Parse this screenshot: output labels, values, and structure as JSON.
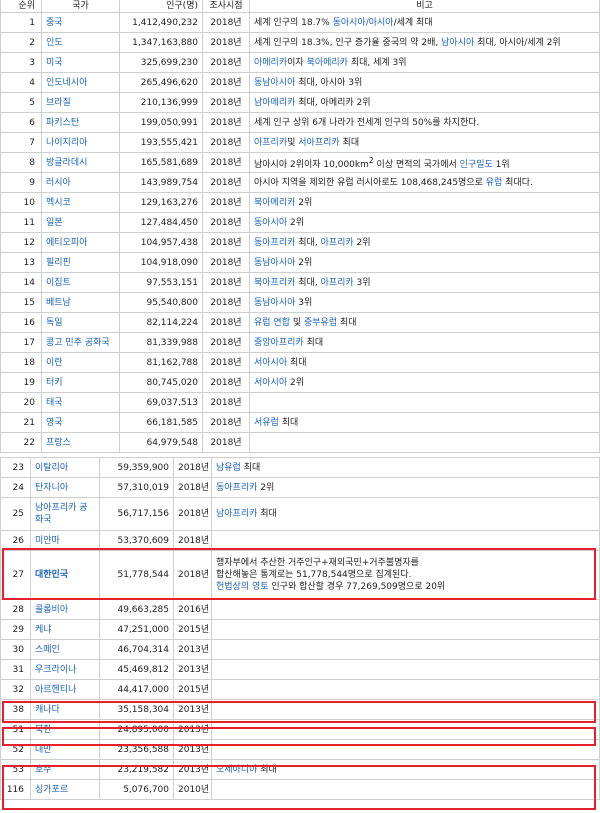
{
  "headers": [
    "순위",
    "국가",
    "인구(명)",
    "조사시점",
    "비고"
  ],
  "rows_top": [
    {
      "rank": "1",
      "country": "중국",
      "pop": "1,412,490,232",
      "year": "2018년",
      "note": [
        [
          "t",
          "세계 인구의 18.7% "
        ],
        [
          "l",
          "동아시아"
        ],
        [
          "l",
          "/아시아"
        ],
        [
          "t",
          "/세계 최대"
        ]
      ]
    },
    {
      "rank": "2",
      "country": "인도",
      "pop": "1,347,163,880",
      "year": "2018년",
      "note": [
        [
          "t",
          "세계 인구의 18.3%, 인구 증가율 중국의 약 2배, "
        ],
        [
          "l",
          "남아시아"
        ],
        [
          "t",
          " 최대, 아시아/세계 2위"
        ]
      ]
    },
    {
      "rank": "3",
      "country": "미국",
      "pop": "325,699,230",
      "year": "2018년",
      "note": [
        [
          "l",
          "아메리카"
        ],
        [
          "t",
          "이자 "
        ],
        [
          "l",
          "북아메리카"
        ],
        [
          "t",
          " 최대, 세계 3위"
        ]
      ]
    },
    {
      "rank": "4",
      "country": "인도네시아",
      "pop": "265,496,620",
      "year": "2018년",
      "note": [
        [
          "l",
          "동남아시아"
        ],
        [
          "t",
          " 최대, 아시아 3위"
        ]
      ]
    },
    {
      "rank": "5",
      "country": "브라질",
      "pop": "210,136,999",
      "year": "2018년",
      "note": [
        [
          "l",
          "남아메리카"
        ],
        [
          "t",
          " 최대, 아메리카 2위"
        ]
      ]
    },
    {
      "rank": "6",
      "country": "파키스탄",
      "pop": "199,050,991",
      "year": "2018년",
      "note": [
        [
          "t",
          "세계 인구 상위 6개 나라가 전세계 인구의 50%를 차지한다."
        ]
      ]
    },
    {
      "rank": "7",
      "country": "나이지리아",
      "pop": "193,555,421",
      "year": "2018년",
      "note": [
        [
          "l",
          "아프리카"
        ],
        [
          "t",
          "및 "
        ],
        [
          "l",
          "서아프리카"
        ],
        [
          "t",
          " 최대"
        ]
      ]
    },
    {
      "rank": "8",
      "country": "방글라데시",
      "pop": "165,581,689",
      "year": "2018년",
      "note": [
        [
          "t",
          "남아시아 2위이자 10,000km"
        ],
        [
          "s",
          "2"
        ],
        [
          "t",
          " 이상 면적의 국가에서 "
        ],
        [
          "l",
          "인구밀도"
        ],
        [
          "t",
          " 1위"
        ]
      ]
    },
    {
      "rank": "9",
      "country": "러시아",
      "pop": "143,989,754",
      "year": "2018년",
      "note": [
        [
          "t",
          "아시아 지역을 제외한 유럽 러시아로도 108,468,245명으로 "
        ],
        [
          "l",
          "유럽"
        ],
        [
          "t",
          " 최대다."
        ]
      ]
    },
    {
      "rank": "10",
      "country": "멕시코",
      "pop": "129,163,276",
      "year": "2018년",
      "note": [
        [
          "l",
          "북아메리카"
        ],
        [
          "t",
          " 2위"
        ]
      ]
    },
    {
      "rank": "11",
      "country": "일본",
      "pop": "127,484,450",
      "year": "2018년",
      "note": [
        [
          "l",
          "동아시아"
        ],
        [
          "t",
          " 2위"
        ]
      ]
    },
    {
      "rank": "12",
      "country": "에티오피아",
      "pop": "104,957,438",
      "year": "2018년",
      "note": [
        [
          "l",
          "동아프리카"
        ],
        [
          "t",
          " 최대, "
        ],
        [
          "l",
          "아프리카"
        ],
        [
          "t",
          " 2위"
        ]
      ]
    },
    {
      "rank": "13",
      "country": "필리핀",
      "pop": "104,918,090",
      "year": "2018년",
      "note": [
        [
          "l",
          "동남아시아"
        ],
        [
          "t",
          " 2위"
        ]
      ]
    },
    {
      "rank": "14",
      "country": "이집트",
      "pop": "97,553,151",
      "year": "2018년",
      "note": [
        [
          "l",
          "북아프리카"
        ],
        [
          "t",
          " 최대, "
        ],
        [
          "l",
          "아프리카"
        ],
        [
          "t",
          " 3위"
        ]
      ]
    },
    {
      "rank": "15",
      "country": "베트남",
      "pop": "95,540,800",
      "year": "2018년",
      "note": [
        [
          "l",
          "동남아시아"
        ],
        [
          "t",
          " 3위"
        ]
      ]
    },
    {
      "rank": "16",
      "country": "독일",
      "pop": "82,114,224",
      "year": "2018년",
      "note": [
        [
          "l",
          "유럽 연합"
        ],
        [
          "t",
          " 및 "
        ],
        [
          "l",
          "중부유럽"
        ],
        [
          "t",
          " 최대"
        ]
      ]
    },
    {
      "rank": "17",
      "country": "콩고 민주 공화국",
      "pop": "81,339,988",
      "year": "2018년",
      "note": [
        [
          "l",
          "중앙아프리카"
        ],
        [
          "t",
          " 최대"
        ]
      ]
    },
    {
      "rank": "18",
      "country": "이란",
      "pop": "81,162,788",
      "year": "2018년",
      "note": [
        [
          "l",
          "서아시아"
        ],
        [
          "t",
          " 최대"
        ]
      ]
    },
    {
      "rank": "19",
      "country": "터키",
      "pop": "80,745,020",
      "year": "2018년",
      "note": [
        [
          "l",
          "서아시아"
        ],
        [
          "t",
          " 2위"
        ]
      ]
    },
    {
      "rank": "20",
      "country": "태국",
      "pop": "69,037,513",
      "year": "2018년",
      "note": []
    },
    {
      "rank": "21",
      "country": "영국",
      "pop": "66,181,585",
      "year": "2018년",
      "note": [
        [
          "l",
          "서유럽"
        ],
        [
          "t",
          " 최대"
        ]
      ]
    },
    {
      "rank": "22",
      "country": "프랑스",
      "pop": "64,979,548",
      "year": "2018년",
      "note": []
    }
  ],
  "rows_bottom": [
    {
      "rank": "23",
      "country": "이탈리아",
      "pop": "59,359,900",
      "year": "2018년",
      "note": [
        [
          "l",
          "남유럽"
        ],
        [
          "t",
          " 최대"
        ]
      ]
    },
    {
      "rank": "24",
      "country": "탄자니아",
      "pop": "57,310,019",
      "year": "2018년",
      "note": [
        [
          "l",
          "동아프리카"
        ],
        [
          "t",
          " 2위"
        ]
      ]
    },
    {
      "rank": "25",
      "country": "남아프리카 공화국",
      "pop": "56,717,156",
      "year": "2018년",
      "note": [
        [
          "l",
          "남아프리카"
        ],
        [
          "t",
          " 최대"
        ]
      ],
      "tall": "tall2"
    },
    {
      "rank": "26",
      "country": "미얀마",
      "pop": "53,370,609",
      "year": "2018년",
      "note": []
    },
    {
      "rank": "27",
      "country": "대한민국",
      "pop": "51,778,544",
      "year": "2018년",
      "bold": true,
      "tall": "tall3",
      "note_lines": [
        [
          [
            "t",
            "행자부에서 추산한 거주인구+재외국민+거주불명자를"
          ]
        ],
        [
          [
            "t",
            "합산해놓은 통계로는 51,778,544명으로 집계된다."
          ]
        ],
        [
          [
            "l",
            "헌법상의 영토"
          ],
          [
            "t",
            " 인구와 합산할 경우 77,269,509명으로 20위"
          ]
        ]
      ]
    },
    {
      "rank": "28",
      "country": "콜롬비아",
      "pop": "49,663,285",
      "year": "2016년",
      "note": []
    },
    {
      "rank": "29",
      "country": "케냐",
      "pop": "47,251,000",
      "year": "2015년",
      "note": []
    },
    {
      "rank": "30",
      "country": "스페인",
      "pop": "46,704,314",
      "year": "2013년",
      "note": []
    },
    {
      "rank": "31",
      "country": "우크라이나",
      "pop": "45,469,812",
      "year": "2013년",
      "note": []
    },
    {
      "rank": "32",
      "country": "아르헨티나",
      "pop": "44,417,000",
      "year": "2015년",
      "note": []
    },
    {
      "rank": "38",
      "country": "캐나다",
      "pop": "35,158,304",
      "year": "2013년",
      "note": []
    },
    {
      "rank": "51",
      "country": "북한",
      "pop": "24,895,000",
      "year": "2013년",
      "note": []
    },
    {
      "rank": "52",
      "country": "대만",
      "pop": "23,356,588",
      "year": "2013년",
      "note": []
    },
    {
      "rank": "53",
      "country": "호주",
      "pop": "23,219,582",
      "year": "2013년",
      "note": [
        [
          "l",
          "오세아니아"
        ],
        [
          "t",
          " 최대"
        ]
      ]
    },
    {
      "rank": "116",
      "country": "싱가포르",
      "pop": "5,076,700",
      "year": "2010년",
      "note": []
    }
  ]
}
